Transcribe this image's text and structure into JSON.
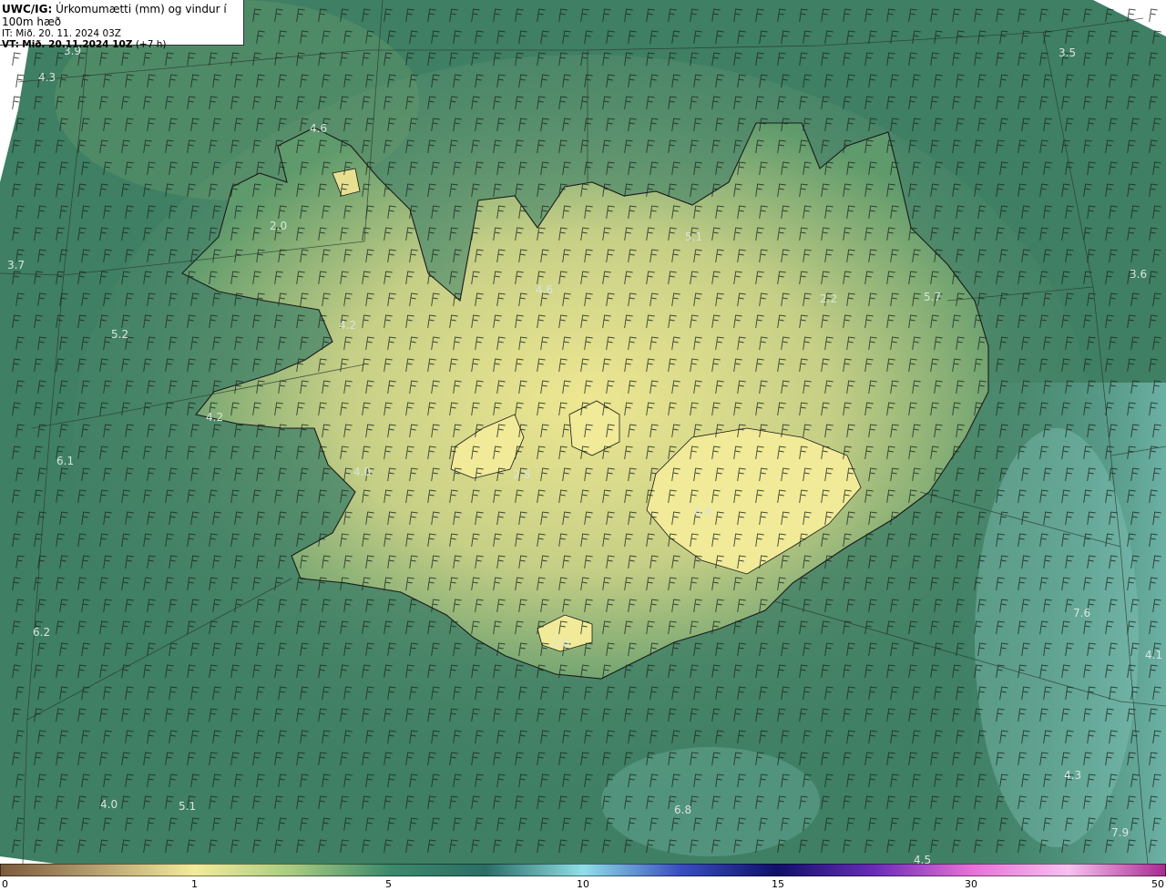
{
  "header": {
    "model": "UWC/IG:",
    "title": "Úrkomumætti (mm) og vindur í 100m hæð",
    "issue_time": "IT: Mið. 20. 11. 2024 03Z",
    "valid_prefix": "VT:",
    "valid_time": "Mið. 20.11.2024 10Z",
    "lead_time": "(+7 h)"
  },
  "map_values": [
    "3.9",
    "4.3",
    "4.6",
    "3.5",
    "2.0",
    "3.7",
    "5.1",
    "3.6",
    "4.6",
    "5.7",
    "5.2",
    "4.2",
    "2.2",
    "6.1",
    "4.0",
    "2.8",
    "6.8",
    "6.2",
    "7.6",
    "4.1",
    "4.0",
    "5.1",
    "6.8",
    "4.3",
    "7.9",
    "4.5",
    "4.2",
    "2.0"
  ],
  "colorbar": {
    "ticks": [
      "0",
      "1",
      "5",
      "10",
      "15",
      "30",
      "50"
    ],
    "colors": [
      "#7a5a3c",
      "#b8a070",
      "#f2ec9a",
      "#a8cc80",
      "#3d8a6c",
      "#2a6e66",
      "#8fe0e8",
      "#3a4ec0",
      "#10106a",
      "#6a2cb8",
      "#e870d8",
      "#f8c0f0",
      "#a82a90"
    ]
  },
  "chart_data": {
    "type": "map",
    "field": "Úrkomumætti (mm)",
    "overlay": "vindur í 100m hæð",
    "scale_ticks": [
      0,
      1,
      5,
      10,
      15,
      30,
      50
    ]
  }
}
